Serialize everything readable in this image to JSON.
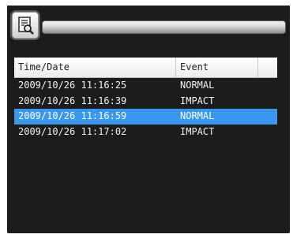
{
  "table": {
    "columns": [
      "Time/Date",
      "Event",
      ""
    ],
    "rows": [
      {
        "time": "2009/10/26 11:16:25",
        "event": "NORMAL",
        "selected": false
      },
      {
        "time": "2009/10/26 11:16:39",
        "event": "IMPACT",
        "selected": false
      },
      {
        "time": "2009/10/26 11:16:59",
        "event": "NORMAL",
        "selected": true
      },
      {
        "time": "2009/10/26 11:17:02",
        "event": "IMPACT",
        "selected": false
      }
    ]
  },
  "colors": {
    "background": "#1c1c1c",
    "selection": "#3a97ef",
    "text": "#f2f2f2"
  },
  "icons": {
    "toolbar_button": "document-search-icon"
  }
}
